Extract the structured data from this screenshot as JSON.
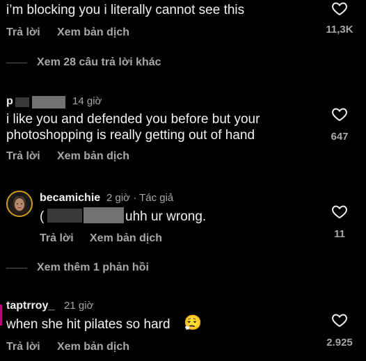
{
  "actions": {
    "reply": "Trả lời",
    "translate": "Xem bản dịch"
  },
  "comments": [
    {
      "text": "i’m blocking you i literally cannot see this",
      "likes": "11,3K"
    },
    {
      "username": "p",
      "time": "14 giờ",
      "text_line1": "i like you and defended you before but your",
      "text_line2": "photoshopping is really getting out of hand",
      "likes": "647"
    },
    {
      "username": "becamichie",
      "time": "2 giờ · Tác giả",
      "text_prefix": "(",
      "text": "uhh ur wrong.",
      "likes": "11"
    },
    {
      "username": "taptrroy_",
      "time": "21 giờ",
      "text": "when she hit pilates so hard",
      "emoji": "😮‍💨",
      "likes": "2.925"
    }
  ],
  "view_more_replies": "Xem 28 câu trả lời khác",
  "view_more_one": "Xem thêm 1 phản hồi",
  "icons": {
    "like": "heart-outline-icon",
    "avatar": "profile-avatar"
  },
  "colors": {
    "background": "#000000",
    "text": "#f2f2f2",
    "secondary": "#a8a8a8"
  }
}
